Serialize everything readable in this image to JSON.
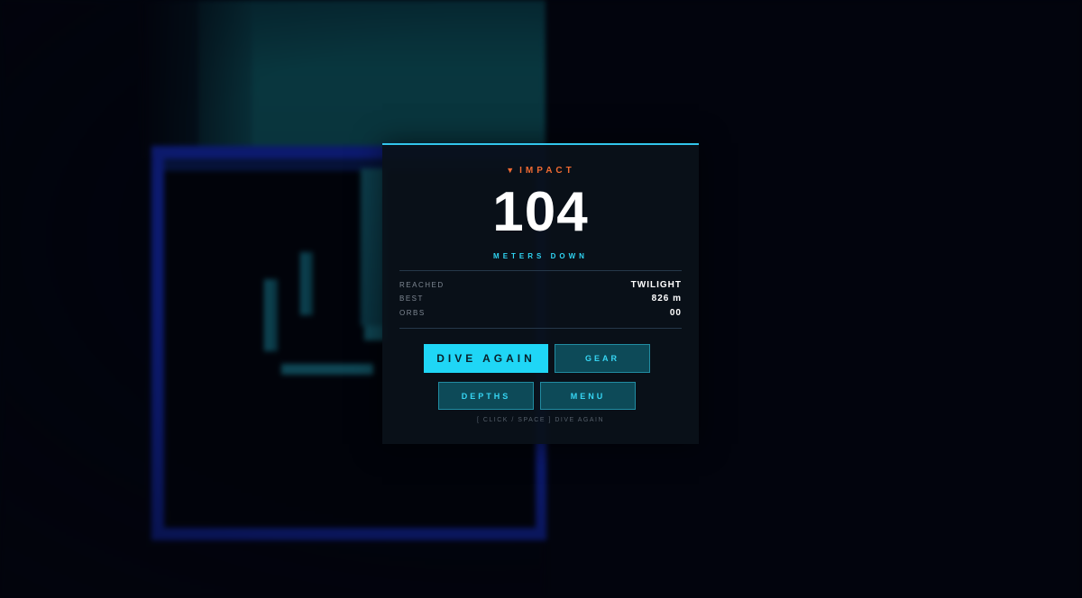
{
  "result": {
    "header": "IMPACT",
    "header_icon": "down-triangle-icon",
    "depth_value": "104",
    "depth_unit": "METERS DOWN"
  },
  "stats": [
    {
      "label": "REACHED",
      "value": "TWILIGHT"
    },
    {
      "label": "BEST",
      "value": "826 m"
    },
    {
      "label": "ORBS",
      "value": "00"
    }
  ],
  "buttons": {
    "dive_again": "DIVE AGAIN",
    "gear": "GEAR",
    "depths": "DEPTHS",
    "menu": "MENU"
  },
  "hint": "[ CLICK / SPACE ] DIVE AGAIN",
  "colors": {
    "accent": "#1fd6f6",
    "impact": "#f06a32",
    "panel_bg": "#0a1119",
    "shaft_border": "#0c1a6e"
  }
}
